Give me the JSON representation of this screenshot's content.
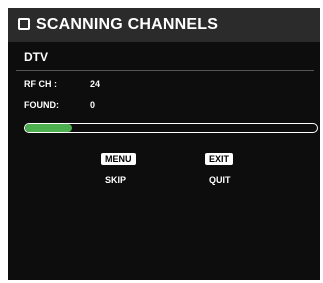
{
  "header": {
    "title": "SCANNING CHANNELS",
    "icon": "square-icon"
  },
  "source": "DTV",
  "status": {
    "rf_label": "RF CH :",
    "rf_value": "24",
    "found_label": "FOUND:",
    "found_value": "0"
  },
  "progress": {
    "fraction": 0.16,
    "color": "#4caf50"
  },
  "keys": {
    "menu": {
      "key": "MENU",
      "action": "SKIP"
    },
    "exit": {
      "key": "EXIT",
      "action": "QUIT"
    }
  }
}
